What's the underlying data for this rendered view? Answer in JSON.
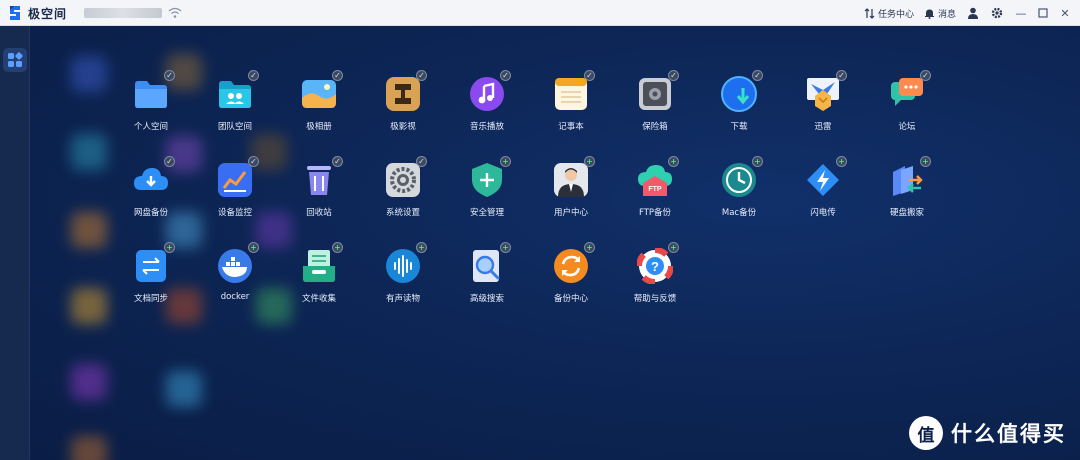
{
  "titlebar": {
    "brand": "极空间",
    "tasks_label": "任务中心",
    "messages_label": "消息"
  },
  "apps": [
    {
      "label": "个人空间",
      "badge": "✓"
    },
    {
      "label": "团队空间",
      "badge": "✓"
    },
    {
      "label": "极相册",
      "badge": "✓"
    },
    {
      "label": "极影视",
      "badge": "✓"
    },
    {
      "label": "音乐播放",
      "badge": "✓"
    },
    {
      "label": "记事本",
      "badge": "✓"
    },
    {
      "label": "保险箱",
      "badge": "✓"
    },
    {
      "label": "下载",
      "badge": "✓"
    },
    {
      "label": "迅雷",
      "badge": "✓"
    },
    {
      "label": "论坛",
      "badge": "✓"
    },
    {
      "label": "网盘备份",
      "badge": "✓"
    },
    {
      "label": "设备监控",
      "badge": "✓"
    },
    {
      "label": "回收站",
      "badge": "✓"
    },
    {
      "label": "系统设置",
      "badge": "✓"
    },
    {
      "label": "安全管理",
      "badge": "+"
    },
    {
      "label": "用户中心",
      "badge": "+"
    },
    {
      "label": "FTP备份",
      "badge": "+"
    },
    {
      "label": "Mac备份",
      "badge": "+"
    },
    {
      "label": "闪电传",
      "badge": "+"
    },
    {
      "label": "硬盘搬家",
      "badge": "+"
    },
    {
      "label": "文档同步",
      "badge": "+"
    },
    {
      "label": "docker",
      "badge": "+"
    },
    {
      "label": "文件收集",
      "badge": "+"
    },
    {
      "label": "有声读物",
      "badge": "+"
    },
    {
      "label": "高级搜索",
      "badge": "+"
    },
    {
      "label": "备份中心",
      "badge": "+"
    },
    {
      "label": "帮助与反馈",
      "badge": "+"
    }
  ],
  "watermark": {
    "circle": "值",
    "text": "什么值得买"
  },
  "colors": {
    "accent": "#1e6ff0",
    "desktop_bg": "#0c1f4a"
  }
}
